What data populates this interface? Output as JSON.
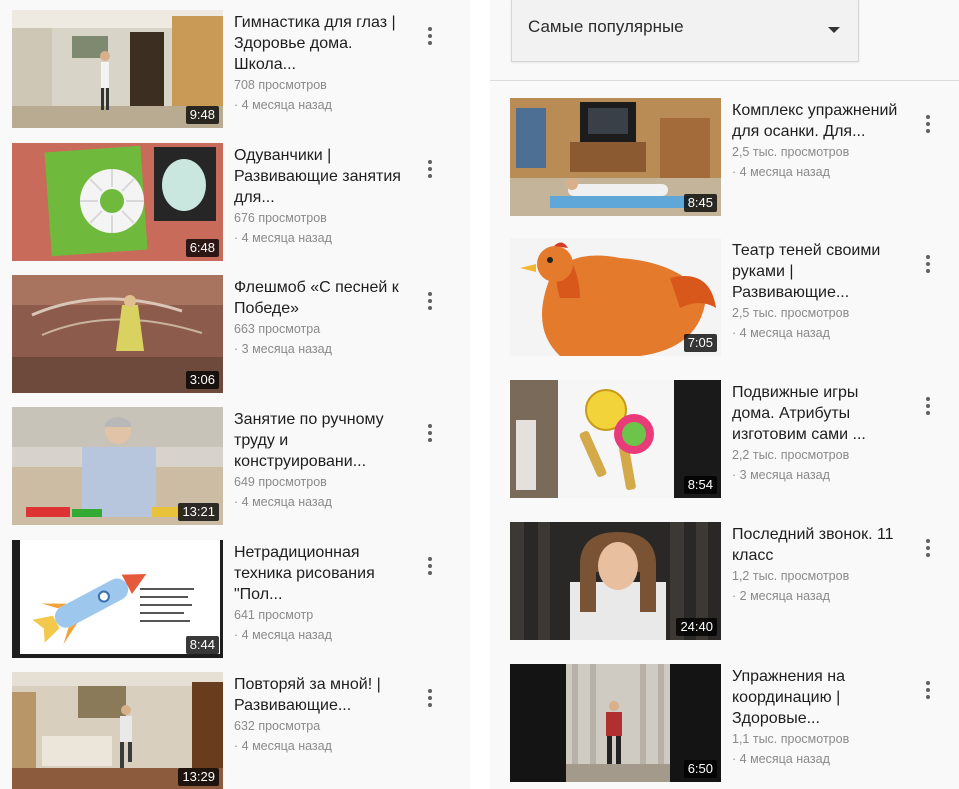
{
  "left_column": [
    {
      "title": "Гимнастика для глаз | Здоровье дома. Школа...",
      "views": "708 просмотров",
      "age": "4 месяца назад",
      "duration": "9:48",
      "thumb": "room"
    },
    {
      "title": "Одуванчики | Развивающие занятия для...",
      "views": "676 просмотров",
      "age": "4 месяца назад",
      "duration": "6:48",
      "thumb": "dandelion"
    },
    {
      "title": "Флешмоб «С песней к Победе»",
      "views": "663 просмотра",
      "age": "3 месяца назад",
      "duration": "3:06",
      "thumb": "flashmob"
    },
    {
      "title": "Занятие по ручному труду и конструировани...",
      "views": "649 просмотров",
      "age": "4 месяца назад",
      "duration": "13:21",
      "thumb": "craft"
    },
    {
      "title": "Нетрадиционная техника рисования \"Пол...",
      "views": "641 просмотр",
      "age": "4 месяца назад",
      "duration": "8:44",
      "thumb": "rocket"
    },
    {
      "title": "Повторяй за мной! | Развивающие...",
      "views": "632 просмотра",
      "age": "4 месяца назад",
      "duration": "13:29",
      "thumb": "exercise"
    }
  ],
  "sort": {
    "label": "Самые популярные"
  },
  "right_column": [
    {
      "title": "Комплекс упражнений для осанки. Для...",
      "views": "2,5 тыс. просмотров",
      "age": "4 месяца назад",
      "duration": "8:45",
      "thumb": "posture"
    },
    {
      "title": "Театр теней своими руками | Развивающие...",
      "views": "2,5 тыс. просмотров",
      "age": "4 месяца назад",
      "duration": "7:05",
      "thumb": "chicken"
    },
    {
      "title": "Подвижные игры дома. Атрибуты изготовим сами ...",
      "views": "2,2 тыс. просмотров",
      "age": "3 месяца назад",
      "duration": "8:54",
      "thumb": "paddles"
    },
    {
      "title": "Последний звонок. 11 класс",
      "views": "1,2 тыс. просмотров",
      "age": "2 месяца назад",
      "duration": "24:40",
      "thumb": "girl"
    },
    {
      "title": "Упражнения на координацию | Здоровые...",
      "views": "1,1 тыс. просмотров",
      "age": "4 месяца назад",
      "duration": "6:50",
      "thumb": "stage"
    }
  ],
  "icons": {
    "more": "more-vert-icon",
    "dropdown": "caret-down-icon"
  }
}
